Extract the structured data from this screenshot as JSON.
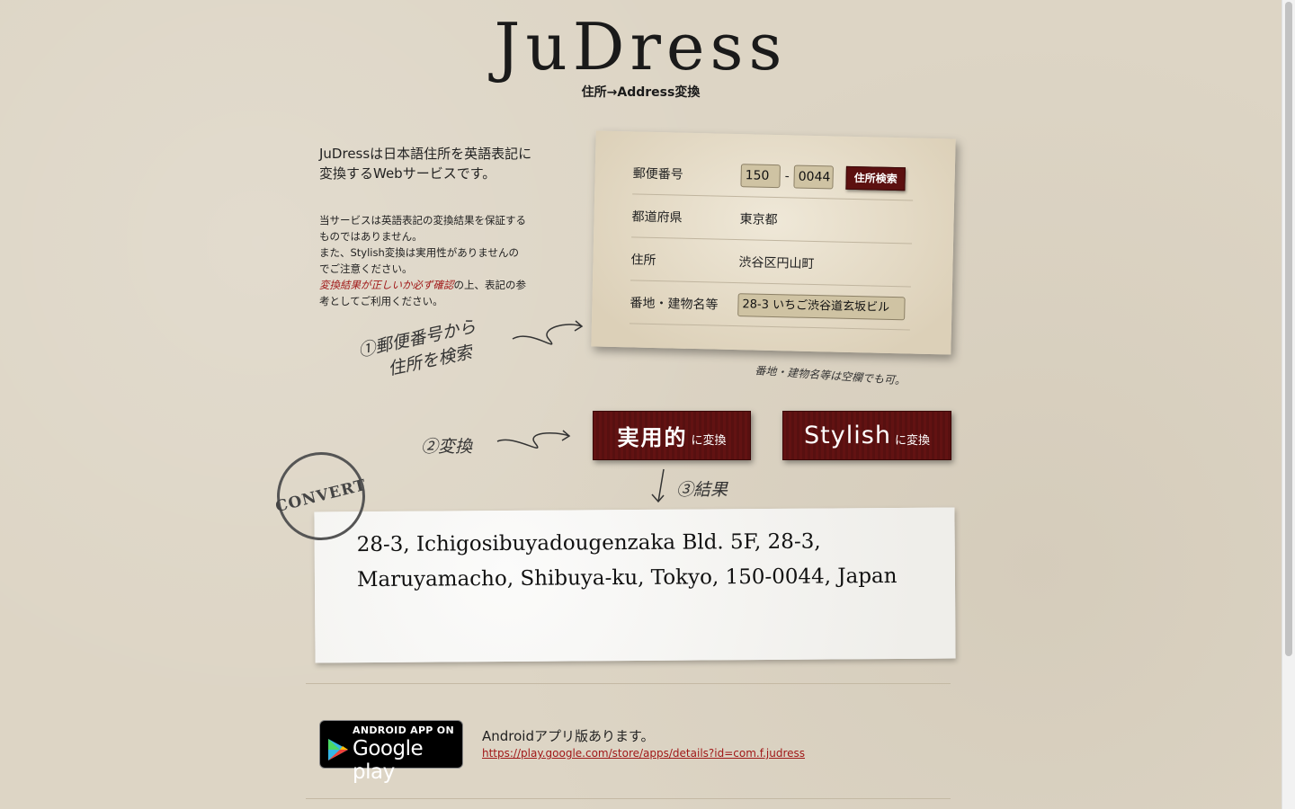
{
  "header": {
    "logo": "JuDress",
    "tagline": "住所→Address変換"
  },
  "intro": {
    "text_line1": "JuDressは日本語住所を英語表記に",
    "text_line2": "変換するWebサービスです。"
  },
  "notice": {
    "line1": "当サービスは英語表記の変換結果を保証する",
    "line2": "ものではありません。",
    "line3": "また、Stylish変換は実用性がありませんの",
    "line4": "でご注意ください。",
    "warn": "変換結果が正しいか必ず確認",
    "line5_after": "の上、表記の参",
    "line6": "考としてご利用ください。"
  },
  "form": {
    "postal_label": "郵便番号",
    "postal_first": "150",
    "postal_separator": "-",
    "postal_second": "0044",
    "search_button": "住所検索",
    "prefecture_label": "都道府県",
    "prefecture_value": "東京都",
    "address_label": "住所",
    "address_value": "渋谷区円山町",
    "building_label": "番地・建物名等",
    "building_value": "28-3 いちご渋谷道玄坂ビル"
  },
  "handwriting": {
    "step1_line1": "①郵便番号から",
    "step1_line2": "住所を検索",
    "building_note": "番地・建物名等は空欄でも可。",
    "step2": "②変換",
    "step3": "③結果"
  },
  "buttons": {
    "practical_main": "実用的",
    "practical_sub": "に変換",
    "stylish_main": "Stylish",
    "stylish_sub": "に変換"
  },
  "stamp": "CONVERT",
  "result": {
    "line1": "28-3, Ichigosibuyadougenzaka Bld. 5F, 28-3,",
    "line2": "Maruyamacho, Shibuya-ku, Tokyo, 150-0044, Japan"
  },
  "android": {
    "badge_top": "ANDROID APP ON",
    "badge_bottom": "Google play",
    "text": "Androidアプリ版あります。",
    "link": "https://play.google.com/store/apps/details?id=com.f.judress"
  },
  "colors": {
    "background": "#ddd5c5",
    "accent": "#5c1010",
    "warning": "#a01818"
  }
}
